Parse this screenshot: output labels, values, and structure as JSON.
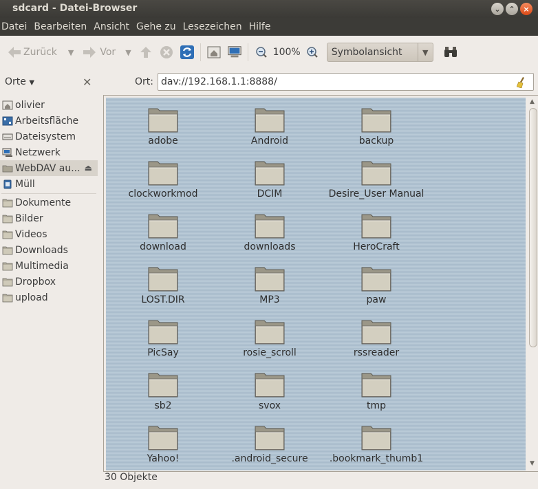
{
  "window": {
    "title": "sdcard - Datei-Browser"
  },
  "menu": [
    "Datei",
    "Bearbeiten",
    "Ansicht",
    "Gehe zu",
    "Lesezeichen",
    "Hilfe"
  ],
  "toolbar": {
    "back_label": "Zurück",
    "forward_label": "Vor",
    "zoom_level": "100%",
    "view_mode": "Symbolansicht"
  },
  "location": {
    "places_header": "Orte",
    "ort_label": "Ort:",
    "address": "dav://192.168.1.1:8888/"
  },
  "sidebar": {
    "devices": [
      {
        "label": "olivier",
        "icon": "home-icon"
      },
      {
        "label": "Arbeitsfläche",
        "icon": "desktop-icon"
      },
      {
        "label": "Dateisystem",
        "icon": "drive-icon"
      },
      {
        "label": "Netzwerk",
        "icon": "network-icon"
      },
      {
        "label": "WebDAV au...",
        "icon": "network-share-icon",
        "selected": true
      },
      {
        "label": "Müll",
        "icon": "trash-icon"
      }
    ],
    "bookmarks": [
      {
        "label": "Dokumente",
        "icon": "folder-icon"
      },
      {
        "label": "Bilder",
        "icon": "folder-icon"
      },
      {
        "label": "Videos",
        "icon": "folder-icon"
      },
      {
        "label": "Downloads",
        "icon": "folder-icon"
      },
      {
        "label": "Multimedia",
        "icon": "folder-icon"
      },
      {
        "label": "Dropbox",
        "icon": "folder-icon"
      },
      {
        "label": "upload",
        "icon": "folder-icon"
      }
    ]
  },
  "files": [
    "adobe",
    "Android",
    "backup",
    "clockworkmod",
    "DCIM",
    "Desire_User Manual",
    "download",
    "downloads",
    "HeroCraft",
    "LOST.DIR",
    "MP3",
    "paw",
    "PicSay",
    "rosie_scroll",
    "rssreader",
    "sb2",
    "svox",
    "tmp",
    "Yahoo!",
    ".android_secure",
    ".bookmark_thumb1"
  ],
  "status": {
    "text": "30 Objekte"
  },
  "colors": {
    "titlebar": "#3c3b37",
    "view_background": "#b9cad7",
    "accent_close": "#dc4a17"
  }
}
